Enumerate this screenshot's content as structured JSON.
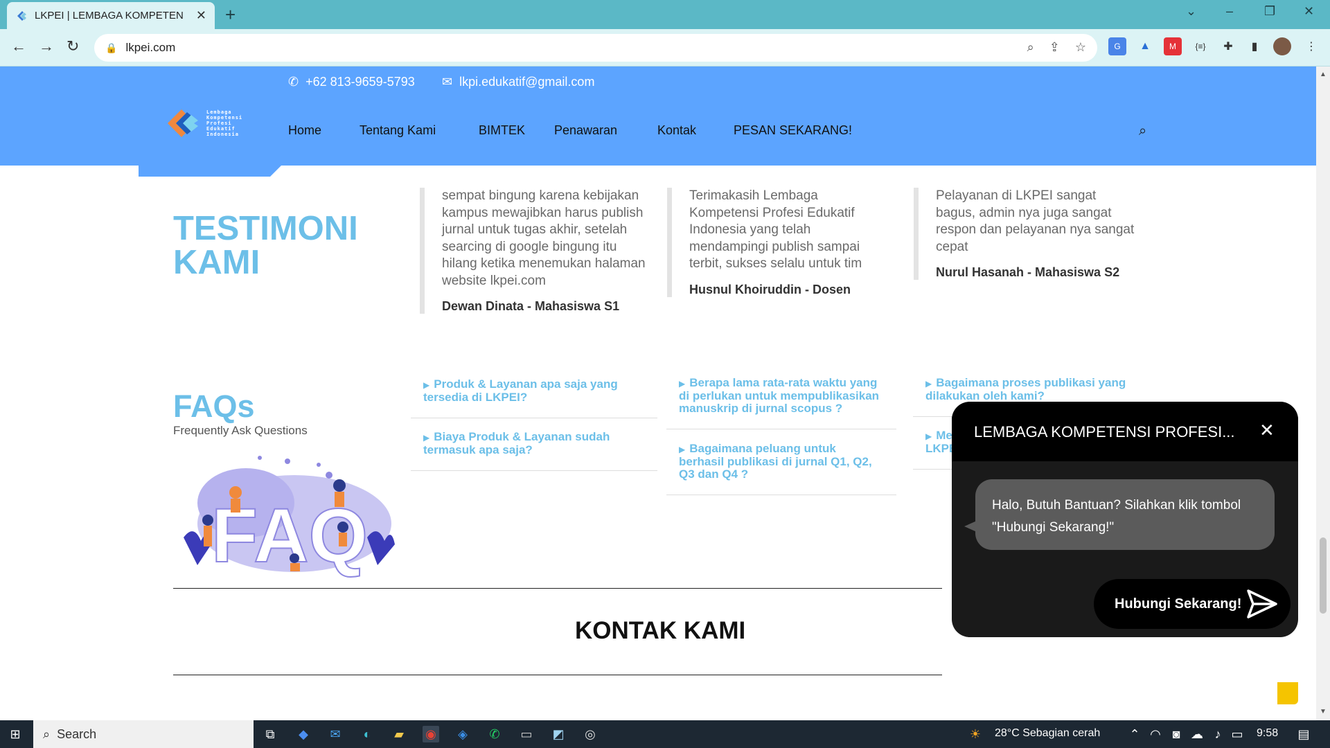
{
  "browser": {
    "tab_title": "LKPEI | LEMBAGA KOMPETENSI P",
    "url": "lkpei.com",
    "new_tab": "+",
    "tab_close": "✕"
  },
  "header": {
    "phone": "+62 813-9659-5793",
    "email": "lkpi.edukatif@gmail.com",
    "logo_lines": [
      "Lembaga",
      "Kompetensi",
      "Profesi",
      "Edukatif",
      "Indonesia"
    ],
    "nav": [
      "Home",
      "Tentang Kami",
      "BIMTEK",
      "Penawaran",
      "Kontak",
      "PESAN SEKARANG!"
    ]
  },
  "testimoni": {
    "heading_line1": "TESTIMONI",
    "heading_line2": "KAMI",
    "items": [
      {
        "text": "sempat bingung karena kebijakan kampus mewajibkan harus publish jurnal untuk tugas akhir, setelah searcing di google bingung itu hilang ketika menemukan halaman website lkpei.com",
        "author": "Dewan Dinata - Mahasiswa S1"
      },
      {
        "text": "Terimakasih Lembaga Kompetensi Profesi Edukatif Indonesia yang telah mendampingi publish sampai terbit, sukses selalu untuk tim",
        "author": "Husnul Khoiruddin - Dosen"
      },
      {
        "text": "Pelayanan di LKPEI sangat bagus, admin nya juga sangat respon dan pelayanan nya sangat cepat",
        "author": "Nurul Hasanah - Mahasiswa S2"
      }
    ]
  },
  "faq": {
    "heading": "FAQs",
    "subtitle": "Frequently Ask Questions",
    "illustration_text": "FAQ",
    "items": [
      "Produk & Layanan apa saja yang tersedia di LKPEI?",
      "Biaya Produk & Layanan sudah termasuk apa saja?",
      "Berapa lama rata-rata waktu yang di perlukan untuk mempublikasikan manuskrip di jurnal scopus ?",
      "Bagaimana peluang untuk berhasil publikasi di jurnal Q1, Q2, Q3 dan Q4 ?",
      "Bagaimana proses publikasi yang dilakukan oleh kami?",
      "Mengapa saya harus memilih LKPEI?"
    ]
  },
  "kontak": {
    "heading": "KONTAK KAMI"
  },
  "chat": {
    "title": "LEMBAGA KOMPETENSI PROFESI...",
    "close": "✕",
    "message": "Halo, Butuh Bantuan? Silahkan klik tombol \"Hubungi Sekarang!\"",
    "button": "Hubungi Sekarang!"
  },
  "taskbar": {
    "search": "Search",
    "weather": "28°C  Sebagian cerah",
    "time": "9:58"
  },
  "colors": {
    "header_blue": "#5ca4ff",
    "accent_light_blue": "#6cbfe8",
    "browser_teal": "#5bb8c6"
  }
}
